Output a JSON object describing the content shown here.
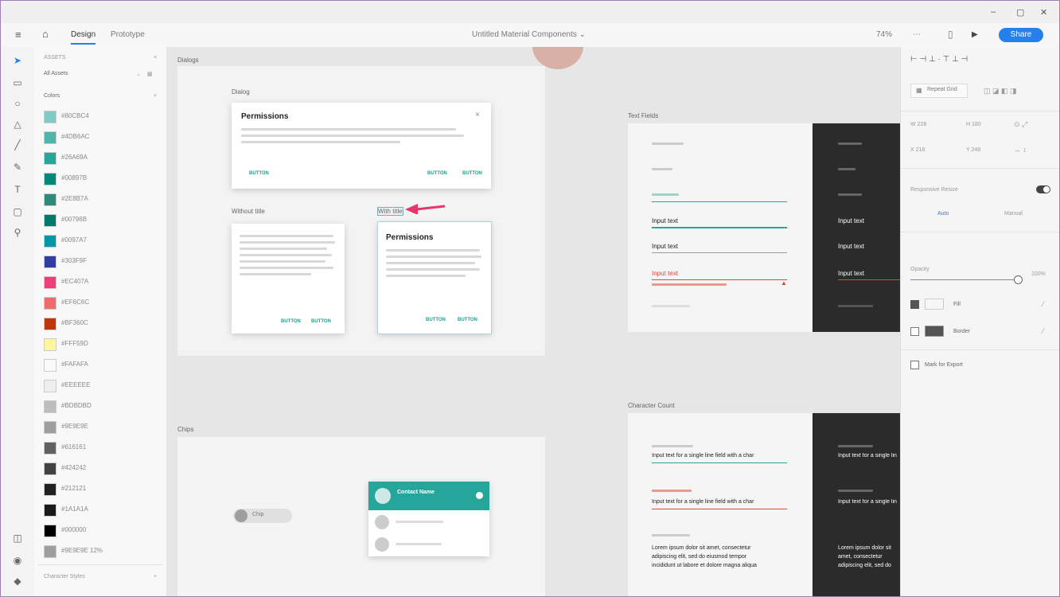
{
  "window": {
    "minimize": "–",
    "maximize": "▢",
    "close": "✕"
  },
  "appbar": {
    "tabs": [
      {
        "label": "Design"
      },
      {
        "label": "Prototype"
      }
    ],
    "doc_title": "Untitled Material Components ⌄",
    "zoom": "74%",
    "share_label": "Share"
  },
  "assets": {
    "header": "ASSETS",
    "filter": "All Assets",
    "section": "Colors",
    "colors": [
      {
        "label": "#80CBC4",
        "color": "#80cbc4"
      },
      {
        "label": "#4DB6AC",
        "color": "#4db6ac"
      },
      {
        "label": "#26A69A",
        "color": "#26a69a"
      },
      {
        "label": "#00897B",
        "color": "#00897b"
      },
      {
        "label": "#2E8B7A",
        "color": "#2e8b7a"
      },
      {
        "label": "#00796B",
        "color": "#00796b"
      },
      {
        "label": "#0097A7",
        "color": "#0097a7"
      },
      {
        "label": "#303F9F",
        "color": "#303f9f"
      },
      {
        "label": "#EC407A",
        "color": "#ec407a"
      },
      {
        "label": "#EF6C6C",
        "color": "#ef6c6c"
      },
      {
        "label": "#BF360C",
        "color": "#bf360c"
      },
      {
        "label": "#FFF59D",
        "color": "#fff59d"
      },
      {
        "label": "#FAFAFA",
        "color": "#fafafa"
      },
      {
        "label": "#EEEEEE",
        "color": "#eeeeee"
      },
      {
        "label": "#BDBDBD",
        "color": "#bdbdbd"
      },
      {
        "label": "#9E9E9E",
        "color": "#9e9e9e"
      },
      {
        "label": "#616161",
        "color": "#616161"
      },
      {
        "label": "#424242",
        "color": "#424242"
      },
      {
        "label": "#212121",
        "color": "#212121"
      },
      {
        "label": "#1A1A1A",
        "color": "#1a1a1a"
      },
      {
        "label": "#000000",
        "color": "#000000"
      },
      {
        "label": "#9E9E9E 12%",
        "color": "#9e9e9e"
      }
    ],
    "footer": "Character Styles"
  },
  "canvas": {
    "dialogs_label": "Dialogs",
    "dialog_top_label": "Dialog",
    "dialog_title": "Permissions",
    "dialog_left_label": "Without title",
    "dialog_right_label": "With title",
    "btn_text": "BUTTON",
    "text_fields_label": "Text Fields",
    "field_samples": [
      "Input text",
      "Input text",
      "Input text"
    ],
    "character_counter_label": "Character Count",
    "helper_text": "Input text for a single line field with a char",
    "lorem_text": "Lorem ipsum dolor sit amet, consectetur adipiscing elit, sed do eiusmod tempor incididunt ut labore et dolore magna aliqua",
    "chips_label": "Chips",
    "chip_label": "Chip",
    "list_header": "Contact Name"
  },
  "props": {
    "repeat_grid": "Repeat Grid",
    "w": "W 228",
    "h": "H 180",
    "x": "X 218",
    "y": "Y 248",
    "responsive": "Responsive Resize",
    "auto": "Auto",
    "manual": "Manual",
    "opacity_label": "Opacity",
    "opacity_value": "100%",
    "fill": "Fill",
    "border": "Border",
    "shadow": "Mark for Export"
  }
}
